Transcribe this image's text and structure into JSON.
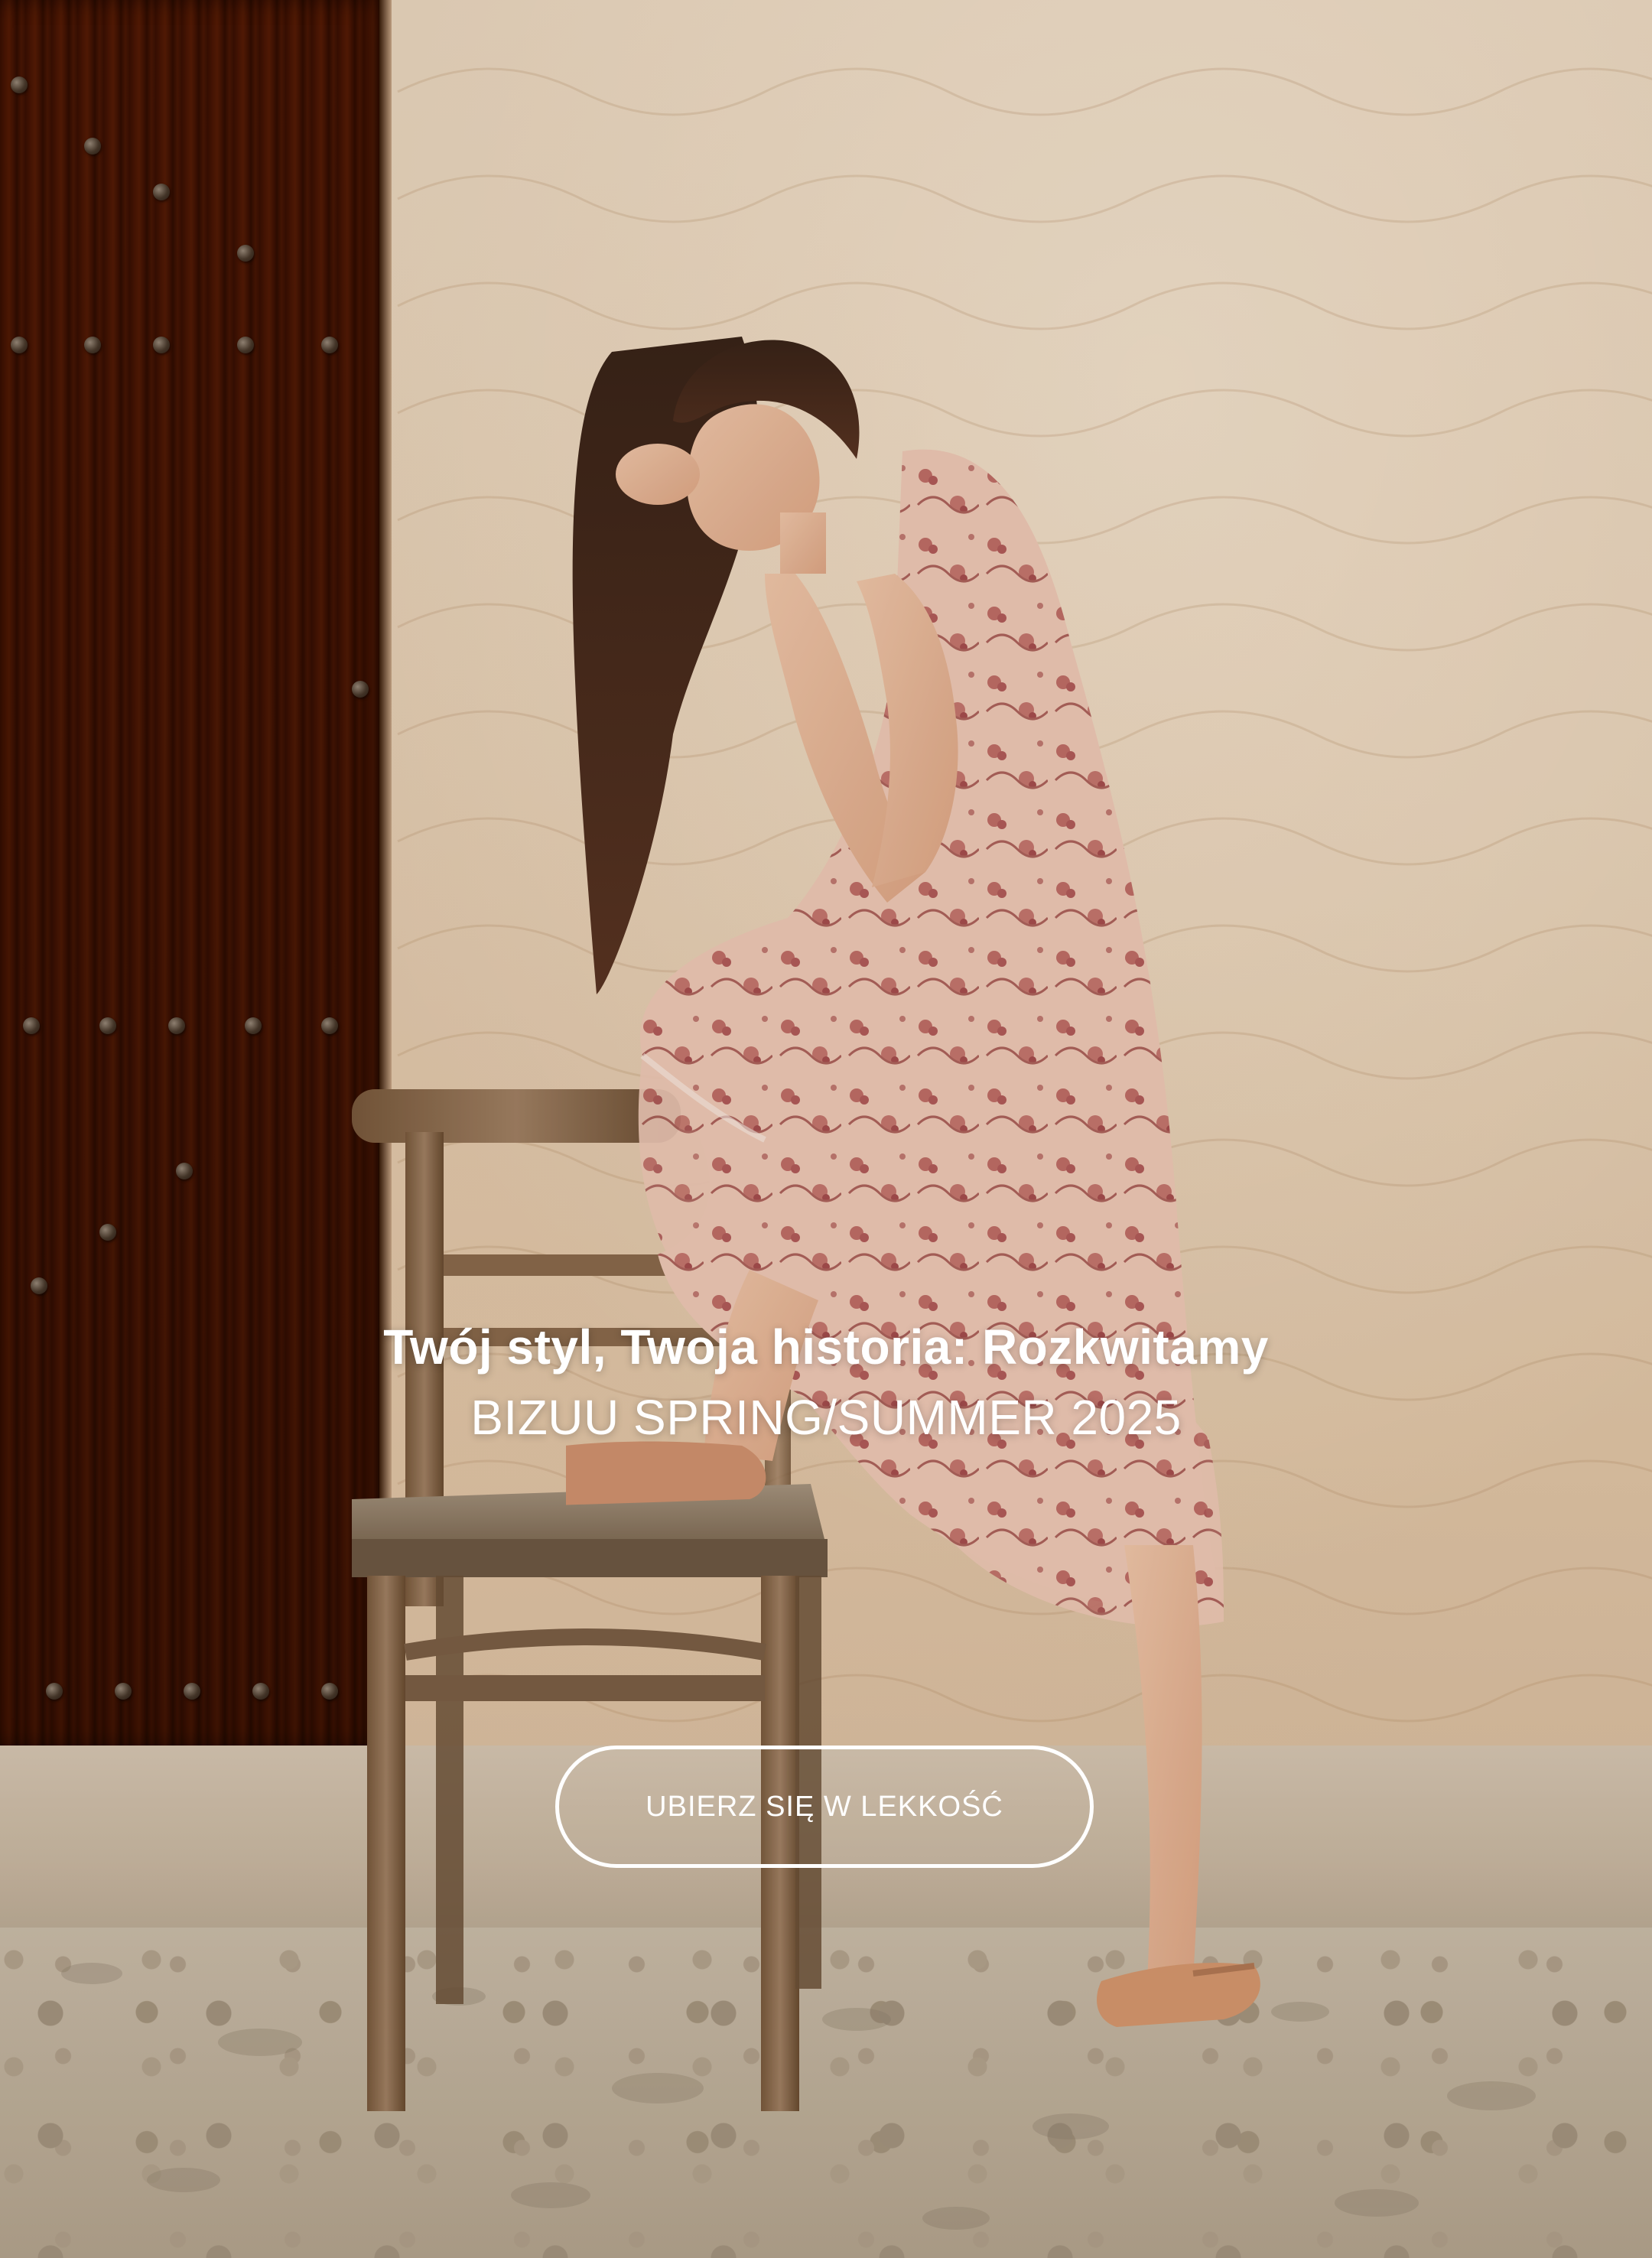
{
  "hero": {
    "title": "Twój styl, Twoja historia: Rozkwitamy",
    "subtitle": "BIZUU SPRING/SUMMER 2025",
    "cta_label": "UBIERZ SIĘ W LEKKOŚĆ",
    "image_alt": "Model in pink floral ruffled dress leaning on a wooden chair in front of a stucco wall"
  },
  "colors": {
    "text": "#ffffff",
    "cta_border": "#ffffff",
    "wall": "#ecd8bf",
    "dress": "#f2c9b6",
    "dress_print": "#b85a5a",
    "door": "#8a4b20"
  }
}
